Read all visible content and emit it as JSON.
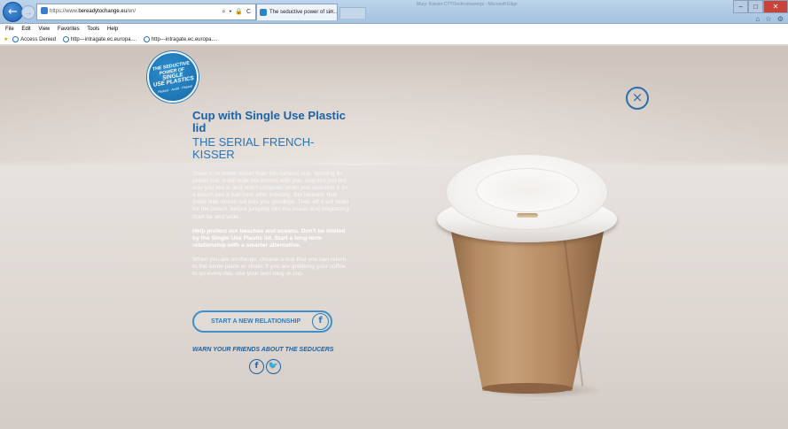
{
  "browser": {
    "url_prefix": "https://www.",
    "url_domain": "bereadytochange.eu",
    "url_suffix": "/en/",
    "address_tools": "⌕ ▾ 🔒 C",
    "tab_title": "The seductive power of sin...",
    "tab_close": "×",
    "window_title_blur": "Mary: Kaisen-CTTOnchromavergs - Microsoft Edge",
    "window_controls": {
      "min": "–",
      "max": "□",
      "close": "✕"
    },
    "right_icons": "⌂ ☆ ⚙",
    "menu": [
      "File",
      "Edit",
      "View",
      "Favorites",
      "Tools",
      "Help"
    ],
    "favorites": [
      "Access Denied",
      "http---intragate.ec.europa....",
      "http---intragate.ec.europa...."
    ]
  },
  "page": {
    "badge": {
      "line1": "THE SEDUCTIVE",
      "line2": "POWER OF",
      "line3": "SINGLE",
      "line4": "USE PLASTICS",
      "line5": "Reduce · Avoid · Repeat"
    },
    "close_label": "×",
    "title": "Cup with Single Use Plastic lid",
    "subtitle": "THE SERIAL FRENCH-KISSER",
    "body_main": "There's no better kisser than this famous cup, sporting its plastic hat. It will walk the streets with you, stay hot just the way you like it, and won't complain when you abandon it on a bench",
    "body_faint": " just a half hour after meeting. But beware, that moist little mouth will kiss you goodbye. Then off it will head for the beach, before jumping into the ocean and disgracing itself far and wide.",
    "cta": "Help protect our beaches and oceans. Don't be misled by the Single Use Plastic lid. Start a long-term relationship with a smarter alternative.",
    "tip": "When you are on-the-go: choose a cup that you can return to the same place or chain. If you are grabbing your coffee to go every day, use your own mug or cup.",
    "relationship_button": "START A NEW RELATIONSHIP",
    "facebook_glyph": "f",
    "twitter_glyph": "🐦",
    "warn": "WARN YOUR FRIENDS ABOUT THE SEDUCERS"
  }
}
